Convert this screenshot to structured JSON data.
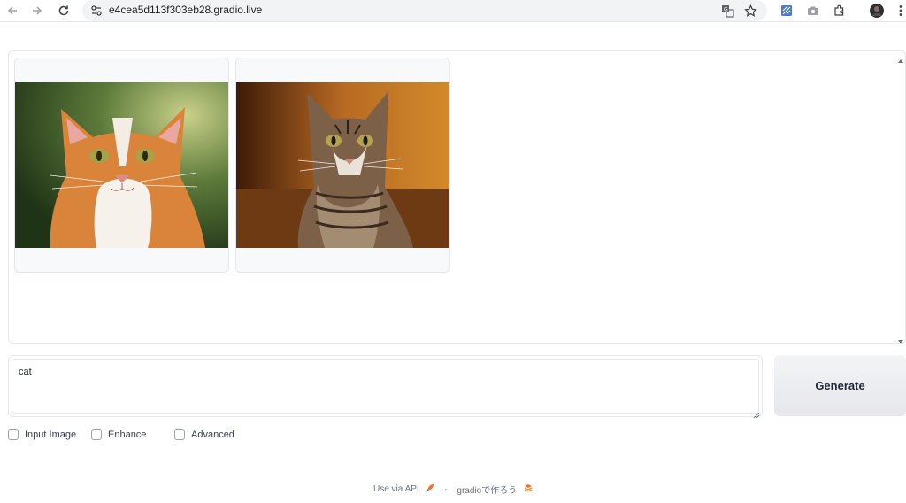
{
  "browser": {
    "url": "e4cea5d113f303eb28.gradio.live",
    "icons": [
      "back-arrow-icon",
      "forward-arrow-icon",
      "reload-icon",
      "site-info-icon",
      "translate-icon",
      "bookmark-star-icon",
      "extension-icon",
      "screenshot-camera-icon",
      "extensions-puzzle-icon",
      "profile-avatar",
      "kebab-menu-icon"
    ]
  },
  "gallery": {
    "images": [
      {
        "alt": "orange and white cat portrait"
      },
      {
        "alt": "brown tabby cat sitting"
      }
    ]
  },
  "prompt": {
    "value": "cat",
    "placeholder": ""
  },
  "generate_label": "Generate",
  "options": [
    {
      "label": "Input Image",
      "checked": false
    },
    {
      "label": "Enhance",
      "checked": false
    },
    {
      "label": "Advanced",
      "checked": false
    }
  ],
  "footer": {
    "api_link": "Use via API",
    "separator": "·",
    "built_with": "gradioで作ろう"
  },
  "colors": {
    "accent_orange": "#f97316",
    "border": "#e5e7eb"
  }
}
